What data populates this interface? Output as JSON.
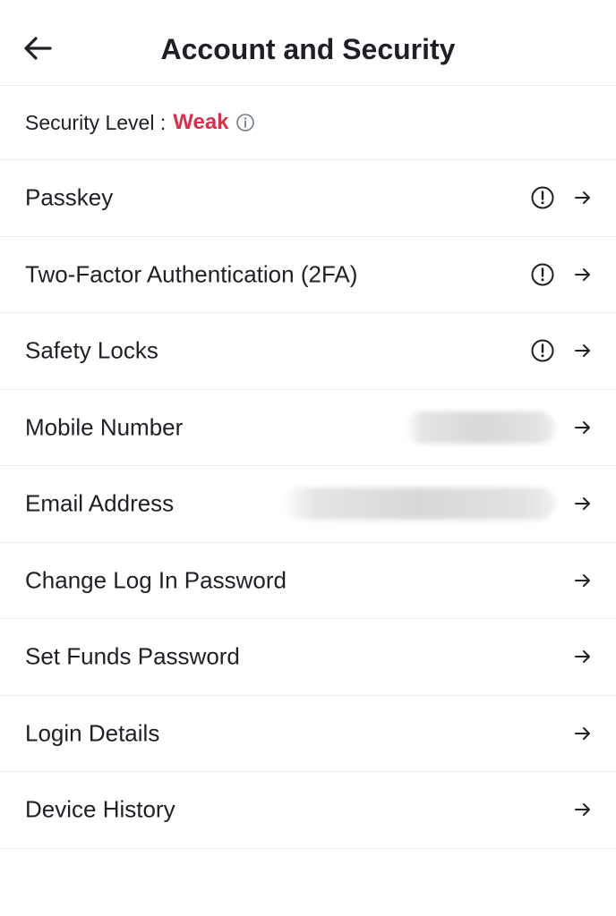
{
  "header": {
    "title": "Account and Security",
    "back_icon": "arrow-left-icon"
  },
  "security": {
    "label": "Security Level :",
    "value": "Weak",
    "value_color": "#d9304e"
  },
  "items": [
    {
      "label": "Passkey",
      "warning": true
    },
    {
      "label": "Two-Factor Authentication (2FA)",
      "warning": true
    },
    {
      "label": "Safety Locks",
      "warning": true
    },
    {
      "label": "Mobile Number",
      "redacted": true
    },
    {
      "label": "Email Address",
      "redacted": true
    },
    {
      "label": "Change Log In Password"
    },
    {
      "label": "Set Funds Password"
    },
    {
      "label": "Login Details"
    },
    {
      "label": "Device History"
    }
  ]
}
